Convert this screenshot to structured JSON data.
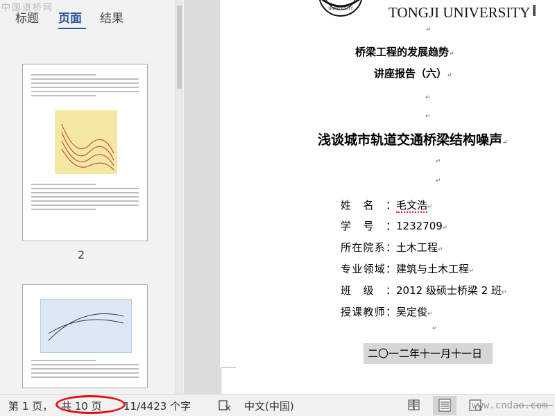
{
  "watermark": "中国道桥网",
  "nav": {
    "tabs": [
      {
        "label": "标题"
      },
      {
        "label": "页面"
      },
      {
        "label": "结果"
      }
    ],
    "active_tab": "页面",
    "thumbnails": [
      {
        "page_label": "2"
      },
      {
        "page_label": ""
      }
    ]
  },
  "document": {
    "university": "TONGJI UNIVERSITY",
    "series_title": "桥梁工程的发展趋势",
    "report_title": "讲座报告（六）",
    "paper_title": "浅谈城市轨道交通桥梁结构噪声",
    "info": [
      {
        "label": "姓名：",
        "value": "毛文浩"
      },
      {
        "label": "学号：",
        "value": "1232709"
      },
      {
        "label": "所在院系：",
        "value": "土木工程"
      },
      {
        "label": "专业领域：",
        "value": "建筑与土木工程"
      },
      {
        "label": "班级：",
        "value": "2012 级硕士桥梁 2 班"
      },
      {
        "label": "授课教师：",
        "value": "吴定俊"
      }
    ],
    "date": "二〇一二年十一月十一日",
    "paragraph_mark": "↵"
  },
  "status": {
    "page": "第 1 页，",
    "total": "共 10 页",
    "words": "11/4423 个字",
    "language": "中文(中国)",
    "site": "www.cndao.com"
  },
  "colors": {
    "accent": "#2b579a",
    "annotation": "#e01010"
  }
}
